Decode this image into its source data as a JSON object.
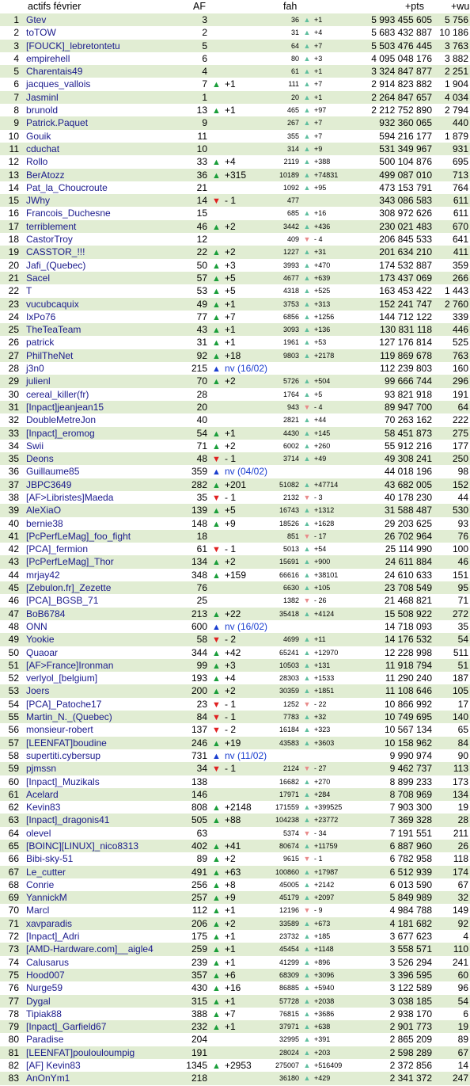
{
  "header": {
    "title": "actifs février",
    "af": "AF",
    "fah": "fah",
    "pts": "+pts",
    "wu": "+wu"
  },
  "rows": [
    {
      "rank": "1",
      "name": "Gtev",
      "af": "3",
      "afc": "",
      "afdir": "",
      "fah": "36",
      "fahdir": "up",
      "fahc": "+1",
      "pts": "5 993 455 605",
      "wu": "5 756"
    },
    {
      "rank": "2",
      "name": "toTOW",
      "af": "2",
      "afc": "",
      "afdir": "",
      "fah": "31",
      "fahdir": "up",
      "fahc": "+4",
      "pts": "5 683 432 887",
      "wu": "10 186"
    },
    {
      "rank": "3",
      "name": "[FOUCK]_lebretontetu",
      "af": "5",
      "afc": "",
      "afdir": "",
      "fah": "64",
      "fahdir": "up",
      "fahc": "+7",
      "pts": "5 503 476 445",
      "wu": "3 763"
    },
    {
      "rank": "4",
      "name": "empirehell",
      "af": "6",
      "afc": "",
      "afdir": "",
      "fah": "80",
      "fahdir": "up",
      "fahc": "+3",
      "pts": "4 095 048 176",
      "wu": "3 882"
    },
    {
      "rank": "5",
      "name": "Charentais49",
      "af": "4",
      "afc": "",
      "afdir": "",
      "fah": "61",
      "fahdir": "up",
      "fahc": "+1",
      "pts": "3 324 847 877",
      "wu": "2 251"
    },
    {
      "rank": "6",
      "name": "jacques_vallois",
      "af": "7",
      "afc": "+1",
      "afdir": "up",
      "fah": "111",
      "fahdir": "up",
      "fahc": "+7",
      "pts": "2 914 823 882",
      "wu": "1 904"
    },
    {
      "rank": "7",
      "name": "Jasminl",
      "af": "1",
      "afc": "",
      "afdir": "",
      "fah": "20",
      "fahdir": "up",
      "fahc": "+1",
      "pts": "2 264 847 657",
      "wu": "4 034"
    },
    {
      "rank": "8",
      "name": "brunold",
      "af": "13",
      "afc": "+1",
      "afdir": "up",
      "fah": "465",
      "fahdir": "up",
      "fahc": "+97",
      "pts": "2 212 752 890",
      "wu": "2 794"
    },
    {
      "rank": "9",
      "name": "Patrick.Paquet",
      "af": "9",
      "afc": "",
      "afdir": "",
      "fah": "267",
      "fahdir": "up",
      "fahc": "+7",
      "pts": "932 360 065",
      "wu": "440"
    },
    {
      "rank": "10",
      "name": "Gouik",
      "af": "11",
      "afc": "",
      "afdir": "",
      "fah": "355",
      "fahdir": "up",
      "fahc": "+7",
      "pts": "594 216 177",
      "wu": "1 879"
    },
    {
      "rank": "11",
      "name": "cduchat",
      "af": "10",
      "afc": "",
      "afdir": "",
      "fah": "314",
      "fahdir": "up",
      "fahc": "+9",
      "pts": "531 349 967",
      "wu": "931"
    },
    {
      "rank": "12",
      "name": "Rollo",
      "af": "33",
      "afc": "+4",
      "afdir": "up",
      "fah": "2119",
      "fahdir": "up",
      "fahc": "+388",
      "pts": "500 104 876",
      "wu": "695"
    },
    {
      "rank": "13",
      "name": "BerAtozz",
      "af": "36",
      "afc": "+315",
      "afdir": "up",
      "fah": "10189",
      "fahdir": "up",
      "fahc": "+74831",
      "pts": "499 087 010",
      "wu": "713"
    },
    {
      "rank": "14",
      "name": "Pat_la_Choucroute",
      "af": "21",
      "afc": "",
      "afdir": "",
      "fah": "1092",
      "fahdir": "up",
      "fahc": "+95",
      "pts": "473 153 791",
      "wu": "764"
    },
    {
      "rank": "15",
      "name": "JWhy",
      "af": "14",
      "afc": "- 1",
      "afdir": "down",
      "fah": "477",
      "fahdir": "",
      "fahc": "",
      "pts": "343 086 583",
      "wu": "611"
    },
    {
      "rank": "16",
      "name": "Francois_Duchesne",
      "af": "15",
      "afc": "",
      "afdir": "",
      "fah": "685",
      "fahdir": "up",
      "fahc": "+16",
      "pts": "308 972 626",
      "wu": "611"
    },
    {
      "rank": "17",
      "name": "terriblement",
      "af": "46",
      "afc": "+2",
      "afdir": "up",
      "fah": "3442",
      "fahdir": "up",
      "fahc": "+436",
      "pts": "230 021 483",
      "wu": "670"
    },
    {
      "rank": "18",
      "name": "CastorTroy",
      "af": "12",
      "afc": "",
      "afdir": "",
      "fah": "409",
      "fahdir": "down",
      "fahc": "- 4",
      "pts": "206 845 533",
      "wu": "641"
    },
    {
      "rank": "19",
      "name": "CASSTOR_!!!",
      "af": "22",
      "afc": "+2",
      "afdir": "up",
      "fah": "1227",
      "fahdir": "up",
      "fahc": "+31",
      "pts": "201 634 210",
      "wu": "411"
    },
    {
      "rank": "20",
      "name": "Jafi_(Quebec)",
      "af": "50",
      "afc": "+3",
      "afdir": "up",
      "fah": "3993",
      "fahdir": "up",
      "fahc": "+470",
      "pts": "174 532 887",
      "wu": "359"
    },
    {
      "rank": "21",
      "name": "Sacel",
      "af": "57",
      "afc": "+5",
      "afdir": "up",
      "fah": "4677",
      "fahdir": "up",
      "fahc": "+639",
      "pts": "173 437 069",
      "wu": "266"
    },
    {
      "rank": "22",
      "name": "T",
      "af": "53",
      "afc": "+5",
      "afdir": "up",
      "fah": "4318",
      "fahdir": "up",
      "fahc": "+525",
      "pts": "163 453 422",
      "wu": "1 443"
    },
    {
      "rank": "23",
      "name": "vucubcaquix",
      "af": "49",
      "afc": "+1",
      "afdir": "up",
      "fah": "3753",
      "fahdir": "up",
      "fahc": "+313",
      "pts": "152 241 747",
      "wu": "2 760"
    },
    {
      "rank": "24",
      "name": "IxPo76",
      "af": "77",
      "afc": "+7",
      "afdir": "up",
      "fah": "6856",
      "fahdir": "up",
      "fahc": "+1256",
      "pts": "144 712 122",
      "wu": "339"
    },
    {
      "rank": "25",
      "name": "TheTeaTeam",
      "af": "43",
      "afc": "+1",
      "afdir": "up",
      "fah": "3093",
      "fahdir": "up",
      "fahc": "+136",
      "pts": "130 831 118",
      "wu": "446"
    },
    {
      "rank": "26",
      "name": "patrick",
      "af": "31",
      "afc": "+1",
      "afdir": "up",
      "fah": "1961",
      "fahdir": "up",
      "fahc": "+53",
      "pts": "127 176 814",
      "wu": "525"
    },
    {
      "rank": "27",
      "name": "PhilTheNet",
      "af": "92",
      "afc": "+18",
      "afdir": "up",
      "fah": "9803",
      "fahdir": "up",
      "fahc": "+2178",
      "pts": "119 869 678",
      "wu": "763"
    },
    {
      "rank": "28",
      "name": "j3n0",
      "af": "215",
      "afc": "nv (16/02)",
      "afdir": "new",
      "fah": "",
      "fahdir": "",
      "fahc": "",
      "pts": "112 239 803",
      "wu": "160"
    },
    {
      "rank": "29",
      "name": "julienl",
      "af": "70",
      "afc": "+2",
      "afdir": "up",
      "fah": "5726",
      "fahdir": "up",
      "fahc": "+504",
      "pts": "99 666 744",
      "wu": "296"
    },
    {
      "rank": "30",
      "name": "cereal_killer(fr)",
      "af": "28",
      "afc": "",
      "afdir": "",
      "fah": "1764",
      "fahdir": "up",
      "fahc": "+5",
      "pts": "93 821 918",
      "wu": "191"
    },
    {
      "rank": "31",
      "name": "[Inpact]jeanjean15",
      "af": "20",
      "afc": "",
      "afdir": "",
      "fah": "943",
      "fahdir": "down",
      "fahc": "- 4",
      "pts": "89 947 700",
      "wu": "64"
    },
    {
      "rank": "32",
      "name": "DoubleMetreJon",
      "af": "40",
      "afc": "",
      "afdir": "",
      "fah": "2821",
      "fahdir": "up",
      "fahc": "+44",
      "pts": "70 263 162",
      "wu": "222"
    },
    {
      "rank": "33",
      "name": "[Inpact]_eromog",
      "af": "54",
      "afc": "+1",
      "afdir": "up",
      "fah": "4430",
      "fahdir": "up",
      "fahc": "+145",
      "pts": "58 451 873",
      "wu": "275"
    },
    {
      "rank": "34",
      "name": "Swii",
      "af": "71",
      "afc": "+2",
      "afdir": "up",
      "fah": "6002",
      "fahdir": "up",
      "fahc": "+260",
      "pts": "55 912 216",
      "wu": "177"
    },
    {
      "rank": "35",
      "name": "Deons",
      "af": "48",
      "afc": "- 1",
      "afdir": "down",
      "fah": "3714",
      "fahdir": "up",
      "fahc": "+49",
      "pts": "49 308 241",
      "wu": "250"
    },
    {
      "rank": "36",
      "name": "Guillaume85",
      "af": "359",
      "afc": "nv (04/02)",
      "afdir": "new",
      "fah": "",
      "fahdir": "",
      "fahc": "",
      "pts": "44 018 196",
      "wu": "98"
    },
    {
      "rank": "37",
      "name": "JBPC3649",
      "af": "282",
      "afc": "+201",
      "afdir": "up",
      "fah": "51082",
      "fahdir": "up",
      "fahc": "+47714",
      "pts": "43 682 005",
      "wu": "152"
    },
    {
      "rank": "38",
      "name": "[AF>Libristes]Maeda",
      "af": "35",
      "afc": "- 1",
      "afdir": "down",
      "fah": "2132",
      "fahdir": "down",
      "fahc": "- 3",
      "pts": "40 178 230",
      "wu": "44"
    },
    {
      "rank": "39",
      "name": "AleXiaO",
      "af": "139",
      "afc": "+5",
      "afdir": "up",
      "fah": "16743",
      "fahdir": "up",
      "fahc": "+1312",
      "pts": "31 588 487",
      "wu": "530"
    },
    {
      "rank": "40",
      "name": "bernie38",
      "af": "148",
      "afc": "+9",
      "afdir": "up",
      "fah": "18526",
      "fahdir": "up",
      "fahc": "+1628",
      "pts": "29 203 625",
      "wu": "93"
    },
    {
      "rank": "41",
      "name": "[PcPerfLeMag]_foo_fight",
      "af": "18",
      "afc": "",
      "afdir": "",
      "fah": "851",
      "fahdir": "down",
      "fahc": "- 17",
      "pts": "26 702 964",
      "wu": "76"
    },
    {
      "rank": "42",
      "name": "[PCA]_fermion",
      "af": "61",
      "afc": "- 1",
      "afdir": "down",
      "fah": "5013",
      "fahdir": "up",
      "fahc": "+54",
      "pts": "25 114 990",
      "wu": "100"
    },
    {
      "rank": "43",
      "name": "[PcPerfLeMag]_Thor",
      "af": "134",
      "afc": "+2",
      "afdir": "up",
      "fah": "15691",
      "fahdir": "up",
      "fahc": "+900",
      "pts": "24 611 884",
      "wu": "46"
    },
    {
      "rank": "44",
      "name": "mrjay42",
      "af": "348",
      "afc": "+159",
      "afdir": "up",
      "fah": "66616",
      "fahdir": "up",
      "fahc": "+38101",
      "pts": "24 610 633",
      "wu": "151"
    },
    {
      "rank": "45",
      "name": "[Zebulon.fr]_Zezette",
      "af": "76",
      "afc": "",
      "afdir": "",
      "fah": "6630",
      "fahdir": "up",
      "fahc": "+105",
      "pts": "23 708 549",
      "wu": "95"
    },
    {
      "rank": "46",
      "name": "[PCA]_BGSB_71",
      "af": "25",
      "afc": "",
      "afdir": "",
      "fah": "1382",
      "fahdir": "down",
      "fahc": "- 26",
      "pts": "21 468 821",
      "wu": "71"
    },
    {
      "rank": "47",
      "name": "BoB6784",
      "af": "213",
      "afc": "+22",
      "afdir": "up",
      "fah": "35418",
      "fahdir": "up",
      "fahc": "+4124",
      "pts": "15 508 922",
      "wu": "272"
    },
    {
      "rank": "48",
      "name": "ONN",
      "af": "600",
      "afc": "nv (16/02)",
      "afdir": "new",
      "fah": "",
      "fahdir": "",
      "fahc": "",
      "pts": "14 718 093",
      "wu": "35"
    },
    {
      "rank": "49",
      "name": "Yookie",
      "af": "58",
      "afc": "- 2",
      "afdir": "down",
      "fah": "4699",
      "fahdir": "up",
      "fahc": "+11",
      "pts": "14 176 532",
      "wu": "54"
    },
    {
      "rank": "50",
      "name": "Quaoar",
      "af": "344",
      "afc": "+42",
      "afdir": "up",
      "fah": "65241",
      "fahdir": "up",
      "fahc": "+12970",
      "pts": "12 228 998",
      "wu": "511"
    },
    {
      "rank": "51",
      "name": "[AF>France]Ironman",
      "af": "99",
      "afc": "+3",
      "afdir": "up",
      "fah": "10503",
      "fahdir": "up",
      "fahc": "+131",
      "pts": "11 918 794",
      "wu": "51"
    },
    {
      "rank": "52",
      "name": "verlyol_[belgium]",
      "af": "193",
      "afc": "+4",
      "afdir": "up",
      "fah": "28303",
      "fahdir": "up",
      "fahc": "+1533",
      "pts": "11 290 240",
      "wu": "187"
    },
    {
      "rank": "53",
      "name": "Joers",
      "af": "200",
      "afc": "+2",
      "afdir": "up",
      "fah": "30359",
      "fahdir": "up",
      "fahc": "+1851",
      "pts": "11 108 646",
      "wu": "105"
    },
    {
      "rank": "54",
      "name": "[PCA]_Patoche17",
      "af": "23",
      "afc": "- 1",
      "afdir": "down",
      "fah": "1252",
      "fahdir": "down",
      "fahc": "- 22",
      "pts": "10 866 992",
      "wu": "17"
    },
    {
      "rank": "55",
      "name": "Martin_N._(Quebec)",
      "af": "84",
      "afc": "- 1",
      "afdir": "down",
      "fah": "7783",
      "fahdir": "up",
      "fahc": "+32",
      "pts": "10 749 695",
      "wu": "140"
    },
    {
      "rank": "56",
      "name": "monsieur-robert",
      "af": "137",
      "afc": "- 2",
      "afdir": "down",
      "fah": "16184",
      "fahdir": "up",
      "fahc": "+323",
      "pts": "10 567 134",
      "wu": "65"
    },
    {
      "rank": "57",
      "name": "[LEENFAT]boudine",
      "af": "246",
      "afc": "+19",
      "afdir": "up",
      "fah": "43583",
      "fahdir": "up",
      "fahc": "+3603",
      "pts": "10 158 962",
      "wu": "84"
    },
    {
      "rank": "58",
      "name": "supertiti.cybersup",
      "af": "731",
      "afc": "nv (11/02)",
      "afdir": "new",
      "fah": "",
      "fahdir": "",
      "fahc": "",
      "pts": "9 990 974",
      "wu": "90"
    },
    {
      "rank": "59",
      "name": "pjmssn",
      "af": "34",
      "afc": "- 1",
      "afdir": "down",
      "fah": "2124",
      "fahdir": "down",
      "fahc": "- 27",
      "pts": "9 462 737",
      "wu": "113"
    },
    {
      "rank": "60",
      "name": "[Inpact]_Muzikals",
      "af": "138",
      "afc": "",
      "afdir": "",
      "fah": "16682",
      "fahdir": "up",
      "fahc": "+270",
      "pts": "8 899 233",
      "wu": "173"
    },
    {
      "rank": "61",
      "name": "Acelard",
      "af": "146",
      "afc": "",
      "afdir": "",
      "fah": "17971",
      "fahdir": "up",
      "fahc": "+284",
      "pts": "8 708 969",
      "wu": "134"
    },
    {
      "rank": "62",
      "name": "Kevin83",
      "af": "808",
      "afc": "+2148",
      "afdir": "up",
      "fah": "171559",
      "fahdir": "up",
      "fahc": "+399525",
      "pts": "7 903 300",
      "wu": "19"
    },
    {
      "rank": "63",
      "name": "[Inpact]_dragonis41",
      "af": "505",
      "afc": "+88",
      "afdir": "up",
      "fah": "104238",
      "fahdir": "up",
      "fahc": "+23772",
      "pts": "7 369 328",
      "wu": "28"
    },
    {
      "rank": "64",
      "name": "olevel",
      "af": "63",
      "afc": "",
      "afdir": "",
      "fah": "5374",
      "fahdir": "down",
      "fahc": "- 34",
      "pts": "7 191 551",
      "wu": "211"
    },
    {
      "rank": "65",
      "name": "[BOINC][LINUX]_nico8313",
      "af": "402",
      "afc": "+41",
      "afdir": "up",
      "fah": "80674",
      "fahdir": "up",
      "fahc": "+11759",
      "pts": "6 887 960",
      "wu": "26"
    },
    {
      "rank": "66",
      "name": "Bibi-sky-51",
      "af": "89",
      "afc": "+2",
      "afdir": "up",
      "fah": "9615",
      "fahdir": "down",
      "fahc": "- 1",
      "pts": "6 782 958",
      "wu": "118"
    },
    {
      "rank": "67",
      "name": "Le_cutter",
      "af": "491",
      "afc": "+63",
      "afdir": "up",
      "fah": "100860",
      "fahdir": "up",
      "fahc": "+17987",
      "pts": "6 512 939",
      "wu": "174"
    },
    {
      "rank": "68",
      "name": "Conrie",
      "af": "256",
      "afc": "+8",
      "afdir": "up",
      "fah": "45005",
      "fahdir": "up",
      "fahc": "+2142",
      "pts": "6 013 590",
      "wu": "67"
    },
    {
      "rank": "69",
      "name": "YannickM",
      "af": "257",
      "afc": "+9",
      "afdir": "up",
      "fah": "45179",
      "fahdir": "up",
      "fahc": "+2097",
      "pts": "5 849 989",
      "wu": "32"
    },
    {
      "rank": "70",
      "name": "Marcl",
      "af": "112",
      "afc": "+1",
      "afdir": "up",
      "fah": "12196",
      "fahdir": "down",
      "fahc": "- 9",
      "pts": "4 984 788",
      "wu": "149"
    },
    {
      "rank": "71",
      "name": "xavparadis",
      "af": "206",
      "afc": "+2",
      "afdir": "up",
      "fah": "33589",
      "fahdir": "up",
      "fahc": "+673",
      "pts": "4 181 682",
      "wu": "92"
    },
    {
      "rank": "72",
      "name": "[Inpact]_Adri",
      "af": "175",
      "afc": "+1",
      "afdir": "up",
      "fah": "23732",
      "fahdir": "up",
      "fahc": "+185",
      "pts": "3 677 623",
      "wu": "4"
    },
    {
      "rank": "73",
      "name": "[AMD-Hardware.com]__aigle4",
      "af": "259",
      "afc": "+1",
      "afdir": "up",
      "fah": "45454",
      "fahdir": "up",
      "fahc": "+1148",
      "pts": "3 558 571",
      "wu": "110"
    },
    {
      "rank": "74",
      "name": "Calusarus",
      "af": "239",
      "afc": "+1",
      "afdir": "up",
      "fah": "41299",
      "fahdir": "up",
      "fahc": "+896",
      "pts": "3 526 294",
      "wu": "241"
    },
    {
      "rank": "75",
      "name": "Hood007",
      "af": "357",
      "afc": "+6",
      "afdir": "up",
      "fah": "68309",
      "fahdir": "up",
      "fahc": "+3096",
      "pts": "3 396 595",
      "wu": "60"
    },
    {
      "rank": "76",
      "name": "Nurge59",
      "af": "430",
      "afc": "+16",
      "afdir": "up",
      "fah": "86885",
      "fahdir": "up",
      "fahc": "+5940",
      "pts": "3 122 589",
      "wu": "96"
    },
    {
      "rank": "77",
      "name": "Dygal",
      "af": "315",
      "afc": "+1",
      "afdir": "up",
      "fah": "57728",
      "fahdir": "up",
      "fahc": "+2038",
      "pts": "3 038 185",
      "wu": "54"
    },
    {
      "rank": "78",
      "name": "Tipiak88",
      "af": "388",
      "afc": "+7",
      "afdir": "up",
      "fah": "76815",
      "fahdir": "up",
      "fahc": "+3686",
      "pts": "2 938 170",
      "wu": "6"
    },
    {
      "rank": "79",
      "name": "[Inpact]_Garfield67",
      "af": "232",
      "afc": "+1",
      "afdir": "up",
      "fah": "37971",
      "fahdir": "up",
      "fahc": "+638",
      "pts": "2 901 773",
      "wu": "19"
    },
    {
      "rank": "80",
      "name": "Paradise",
      "af": "204",
      "afc": "",
      "afdir": "",
      "fah": "32995",
      "fahdir": "up",
      "fahc": "+391",
      "pts": "2 865 209",
      "wu": "89"
    },
    {
      "rank": "81",
      "name": "[LEENFAT]pouloulou​mpig",
      "af": "191",
      "afc": "",
      "afdir": "",
      "fah": "28024",
      "fahdir": "up",
      "fahc": "+203",
      "pts": "2 598 289",
      "wu": "67"
    },
    {
      "rank": "82",
      "name": "[AF] Kevin83",
      "af": "1345",
      "afc": "+2953",
      "afdir": "up",
      "fah": "275007",
      "fahdir": "up",
      "fahc": "+516409",
      "pts": "2 372 856",
      "wu": "14"
    },
    {
      "rank": "83",
      "name": "AnOnYm1",
      "af": "218",
      "afc": "",
      "afdir": "",
      "fah": "36180",
      "fahdir": "up",
      "fahc": "+429",
      "pts": "2 341 372",
      "wu": "247"
    }
  ]
}
